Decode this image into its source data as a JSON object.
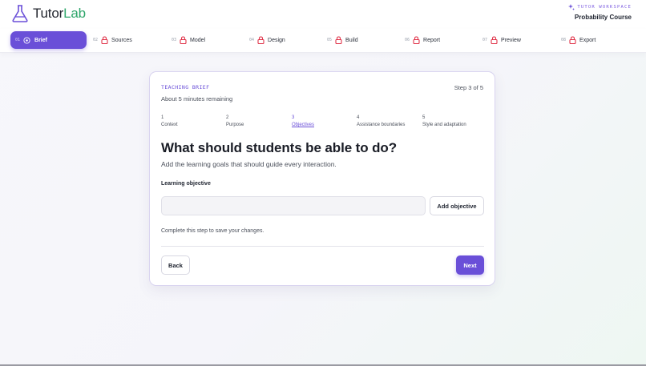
{
  "app": {
    "name_part1": "Tutor",
    "name_part2": "Lab",
    "workspace_label": "TUTOR WORKSPACE",
    "course_name": "Probability Course"
  },
  "nav": {
    "items": [
      {
        "num": "01",
        "label": "Brief",
        "state": "active",
        "icon": "circle-check-icon"
      },
      {
        "num": "02",
        "label": "Sources",
        "state": "locked",
        "icon": "lock-icon"
      },
      {
        "num": "03",
        "label": "Model",
        "state": "locked",
        "icon": "lock-icon"
      },
      {
        "num": "04",
        "label": "Design",
        "state": "locked",
        "icon": "lock-icon"
      },
      {
        "num": "05",
        "label": "Build",
        "state": "locked",
        "icon": "lock-icon"
      },
      {
        "num": "06",
        "label": "Report",
        "state": "locked",
        "icon": "lock-icon"
      },
      {
        "num": "07",
        "label": "Preview",
        "state": "locked",
        "icon": "lock-icon"
      },
      {
        "num": "08",
        "label": "Export",
        "state": "locked",
        "icon": "lock-icon"
      }
    ]
  },
  "card": {
    "eyebrow": "TEACHING BRIEF",
    "step_count": "Step 3 of 5",
    "remaining": "About 5 minutes remaining",
    "substeps": [
      {
        "num": "1",
        "label": "Context"
      },
      {
        "num": "2",
        "label": "Purpose"
      },
      {
        "num": "3",
        "label": "Objectives",
        "current": true
      },
      {
        "num": "4",
        "label": "Assistance boundaries"
      },
      {
        "num": "5",
        "label": "Style and adaptation"
      }
    ],
    "heading": "What should students be able to do?",
    "subheading": "Add the learning goals that should guide every interaction.",
    "field_label": "Learning objective",
    "input_value": "",
    "input_placeholder": "",
    "add_button": "Add objective",
    "save_note": "Complete this step to save your changes.",
    "back_button": "Back",
    "next_button": "Next"
  },
  "colors": {
    "accent": "#6a4fd8",
    "brand_green": "#2fa66b",
    "lock_red": "#e0344a"
  }
}
